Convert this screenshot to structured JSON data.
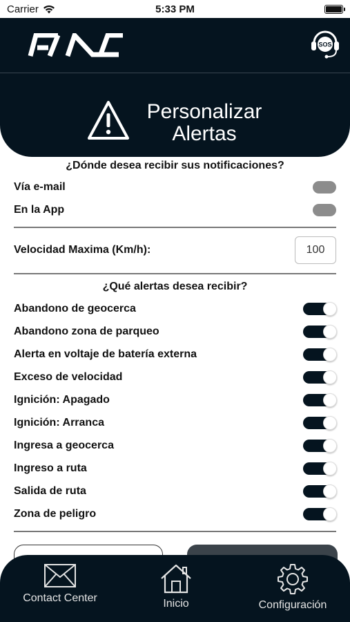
{
  "status_bar": {
    "carrier": "Carrier",
    "time": "5:33 PM"
  },
  "header": {
    "brand": "KIA",
    "sos_label": "SOS"
  },
  "title": {
    "line1": "Personalizar",
    "line2": "Alertas"
  },
  "notifications": {
    "question": "¿Dónde desea recibir sus notificaciones?",
    "options": [
      {
        "label": "Vía e-mail",
        "enabled": false
      },
      {
        "label": "En la App",
        "enabled": false
      }
    ]
  },
  "speed": {
    "label": "Velocidad Maxima (Km/h):",
    "value": "100"
  },
  "alerts": {
    "question": "¿Qué alertas desea recibir?",
    "items": [
      {
        "label": "Abandono de geocerca",
        "enabled": true
      },
      {
        "label": "Abandono zona de parqueo",
        "enabled": true
      },
      {
        "label": "Alerta en voltaje de batería externa",
        "enabled": true
      },
      {
        "label": "Exceso de velocidad",
        "enabled": true
      },
      {
        "label": "Ignición: Apagado",
        "enabled": true
      },
      {
        "label": "Ignición: Arranca",
        "enabled": true
      },
      {
        "label": "Ingresa a geocerca",
        "enabled": true
      },
      {
        "label": "Ingreso a ruta",
        "enabled": true
      },
      {
        "label": "Salida de ruta",
        "enabled": true
      },
      {
        "label": "Zona de peligro",
        "enabled": true
      }
    ]
  },
  "tabs": [
    {
      "label": "Contact Center",
      "icon": "envelope-icon"
    },
    {
      "label": "Inicio",
      "icon": "home-icon"
    },
    {
      "label": "Configuración",
      "icon": "gear-icon"
    }
  ],
  "colors": {
    "brand_dark": "#05141f",
    "toggle_off": "#8c8c8c"
  }
}
